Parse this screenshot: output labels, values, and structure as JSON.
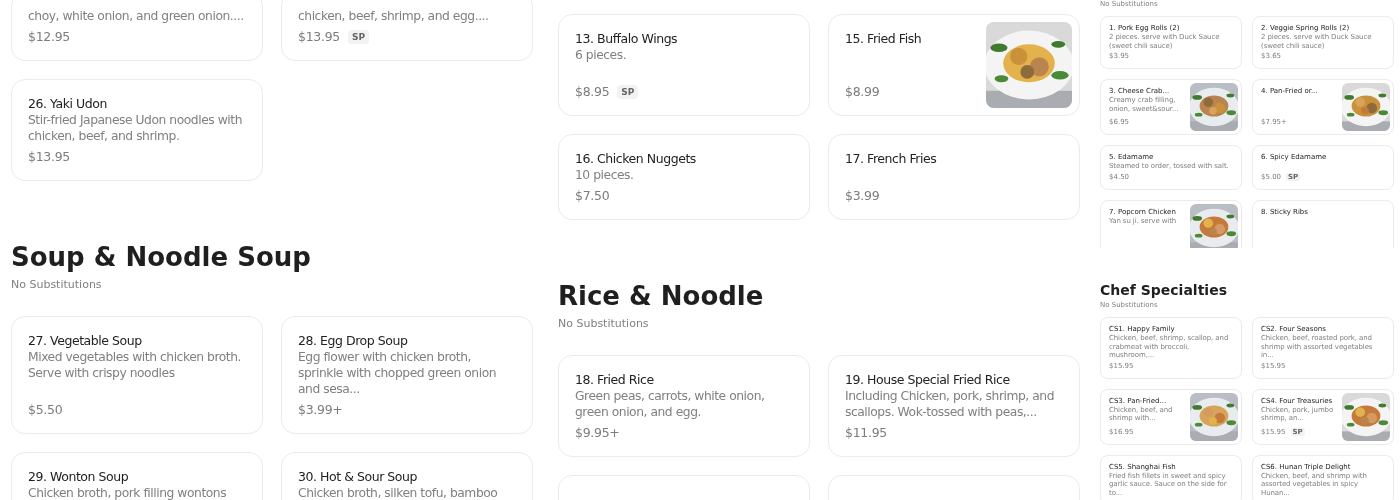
{
  "panes": [
    {
      "sections": [
        {
          "items": [
            {
              "kind": "plain",
              "desc": "choy, white onion, and green onion....",
              "price": "$12.95"
            },
            {
              "kind": "plain",
              "desc": "chicken, beef, shrimp, and egg....",
              "price": "$13.95",
              "badge": "SP"
            },
            {
              "kind": "plain",
              "name": "26. Yaki Udon",
              "desc": "Stir-fried Japanese Udon noodles with chicken, beef, and shrimp.",
              "price": "$13.95"
            }
          ]
        },
        {
          "heading": "Soup & Noodle Soup",
          "note": "No Substitutions",
          "items": [
            {
              "kind": "plain",
              "name": "27. Vegetable Soup",
              "desc": "Mixed vegetables with chicken broth. Serve with crispy noodles",
              "price": "$5.50"
            },
            {
              "kind": "plain",
              "name": "28. Egg Drop Soup",
              "desc": "Egg flower with chicken broth, sprinkle with chopped green onion and sesa...",
              "price": "$3.99+"
            },
            {
              "kind": "plain",
              "name": "29. Wonton Soup",
              "desc": "Chicken broth, pork filling wontons"
            },
            {
              "kind": "plain",
              "name": "30. Hot & Sour Soup",
              "desc": "Chicken broth, silken tofu, bamboo"
            }
          ]
        }
      ]
    },
    {
      "sections": [
        {
          "items": [
            {
              "kind": "plain",
              "name": "13. Buffalo Wings",
              "desc": "6 pieces.",
              "price": "$8.95",
              "badge": "SP"
            },
            {
              "name": "15. Fried Fish",
              "price": "$8.99"
            },
            {
              "kind": "plain",
              "name": "16. Chicken Nuggets",
              "desc": "10 pieces.",
              "price": "$7.50"
            },
            {
              "kind": "plain",
              "name": "17. French Fries",
              "price": "$3.99"
            }
          ]
        },
        {
          "heading": "Rice & Noodle",
          "note": "No Substitutions",
          "items": [
            {
              "kind": "plain",
              "name": "18. Fried Rice",
              "desc": "Green peas, carrots, white onion, green onion, and egg.",
              "price": "$9.95+"
            },
            {
              "kind": "plain",
              "name": "19. House Special Fried Rice",
              "desc": "Including Chicken, pork, shrimp, and scallops. Wok-tossed with peas,...",
              "price": "$11.95"
            },
            {
              "kind": "blank"
            },
            {
              "kind": "blank"
            }
          ]
        }
      ]
    },
    {
      "sections": [
        {
          "note": "No Substitutions",
          "items": [
            {
              "kind": "plain",
              "name": "1. Pork Egg Rolls (2)",
              "desc": "2 pieces. serve with Duck Sauce (sweet chili sauce)",
              "price": "$3.95"
            },
            {
              "kind": "plain",
              "name": "2. Veggie Spring Rolls (2)",
              "desc": "2 pieces. serve with Duck Sauce (sweet chili sauce)",
              "price": "$3.65"
            },
            {
              "name": "3. Cheese Crab...",
              "desc": "Creamy crab filling, onion, sweet&sour...",
              "price": "$6.95"
            },
            {
              "name": "4. Pan-Fried or...",
              "price": "$7.95+"
            },
            {
              "kind": "plain",
              "name": "5. Edamame",
              "desc": "Steamed to order, tossed with salt.",
              "price": "$4.50"
            },
            {
              "kind": "plain",
              "name": "6. Spicy Edamame",
              "price": "$5.00",
              "badge": "SP"
            },
            {
              "name": "7. Popcorn Chicken",
              "desc": "Yan su ji. serve with"
            },
            {
              "kind": "plain",
              "name": "8. Sticky Ribs"
            }
          ]
        },
        {
          "heading": "Chef Specialties",
          "note": "No Substitutions",
          "items": [
            {
              "kind": "plain",
              "name": "CS1. Happy Family",
              "desc": "Chicken, beef, shrimp, scallop, and crabmeat with broccoli, mushroom,...",
              "price": "$15.95"
            },
            {
              "kind": "plain",
              "name": "CS2. Four Seasons",
              "desc": "Chicken, beef, roasted pork, and shrimp with assorted vegetables in...",
              "price": "$15.95"
            },
            {
              "name": "CS3. Pan-Fried...",
              "desc": "Chicken, beef, and shrimp with...",
              "price": "$16.95"
            },
            {
              "name": "CS4. Four Treasuries",
              "desc": "Chicken, pork, jumbo shrimp, an...",
              "price": "$15.95",
              "badge": "SP"
            },
            {
              "kind": "plain",
              "name": "CS5. Shanghai Fish",
              "desc": "Fried fish fillets in sweet and spicy garlic sauce. Sauce on the side for to..."
            },
            {
              "kind": "plain",
              "name": "CS6. Hunan Triple Delight",
              "desc": "Chicken, beef, and shrimp with assorted vegetables in spicy Hunan..."
            }
          ]
        }
      ]
    }
  ]
}
